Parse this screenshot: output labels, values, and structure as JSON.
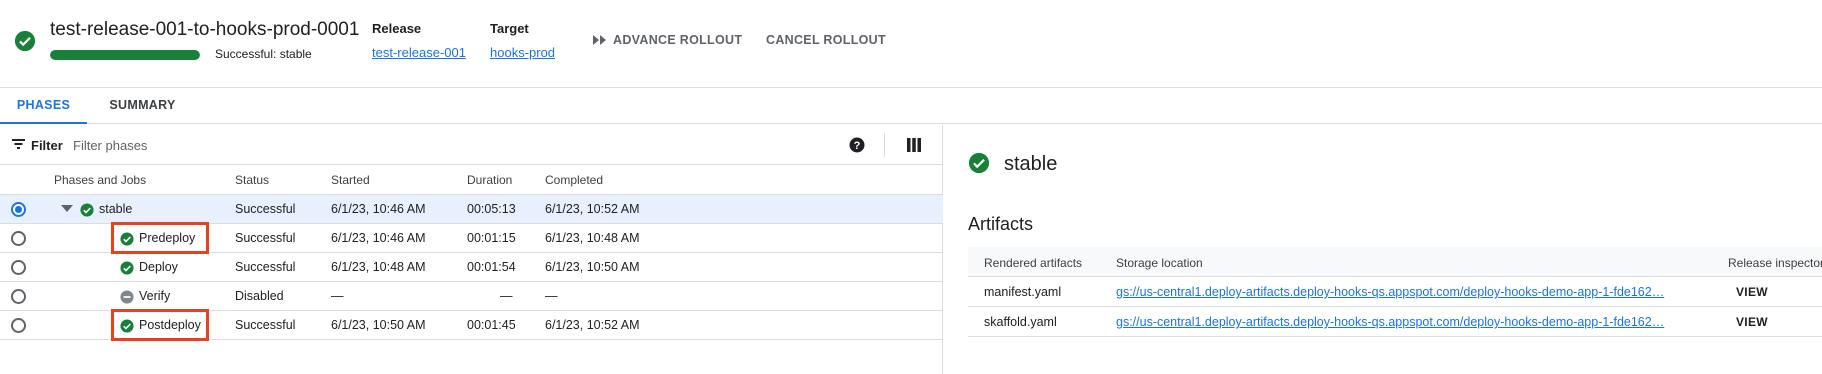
{
  "header": {
    "title": "test-release-001-to-hooks-prod-0001",
    "progress_fraction": 1.0,
    "status": "Successful: stable",
    "release_label": "Release",
    "release_value": "test-release-001",
    "target_label": "Target",
    "target_value": "hooks-prod",
    "advance_label": "ADVANCE ROLLOUT",
    "cancel_label": "CANCEL ROLLOUT",
    "success_color": "#188038",
    "link_color": "#1a73e8"
  },
  "tabs": [
    {
      "label": "PHASES",
      "active": true
    },
    {
      "label": "SUMMARY",
      "active": false
    }
  ],
  "filter": {
    "label": "Filter",
    "placeholder": "Filter phases"
  },
  "table": {
    "columns": [
      "Phases and Jobs",
      "Status",
      "Started",
      "Duration",
      "Completed"
    ],
    "rows": [
      {
        "name": "stable",
        "status": "Successful",
        "started": "6/1/23, 10:46 AM",
        "duration": "00:05:13",
        "completed": "6/1/23, 10:52 AM",
        "icon": "check-circle-icon"
      },
      {
        "name": "Predeploy",
        "status": "Successful",
        "started": "6/1/23, 10:46 AM",
        "duration": "00:01:15",
        "completed": "6/1/23, 10:48 AM",
        "icon": "check-circle-icon"
      },
      {
        "name": "Deploy",
        "status": "Successful",
        "started": "6/1/23, 10:48 AM",
        "duration": "00:01:54",
        "completed": "6/1/23, 10:50 AM",
        "icon": "check-circle-icon"
      },
      {
        "name": "Verify",
        "status": "Disabled",
        "started": "—",
        "duration": "—",
        "completed": "—",
        "icon": "disabled-icon"
      },
      {
        "name": "Postdeploy",
        "status": "Successful",
        "started": "6/1/23, 10:50 AM",
        "duration": "00:01:45",
        "completed": "6/1/23, 10:52 AM",
        "icon": "check-circle-icon"
      }
    ]
  },
  "detail": {
    "title": "stable",
    "section": "Artifacts",
    "columns": [
      "Rendered artifacts",
      "Storage location",
      "Release inspector"
    ],
    "rows": [
      {
        "artifact": "manifest.yaml",
        "location": "gs://us-central1.deploy-artifacts.deploy-hooks-qs.appspot.com/deploy-hooks-demo-app-1-fde162…",
        "action": "VIEW"
      },
      {
        "artifact": "skaffold.yaml",
        "location": "gs://us-central1.deploy-artifacts.deploy-hooks-qs.appspot.com/deploy-hooks-demo-app-1-fde162…",
        "action": "VIEW"
      }
    ]
  }
}
